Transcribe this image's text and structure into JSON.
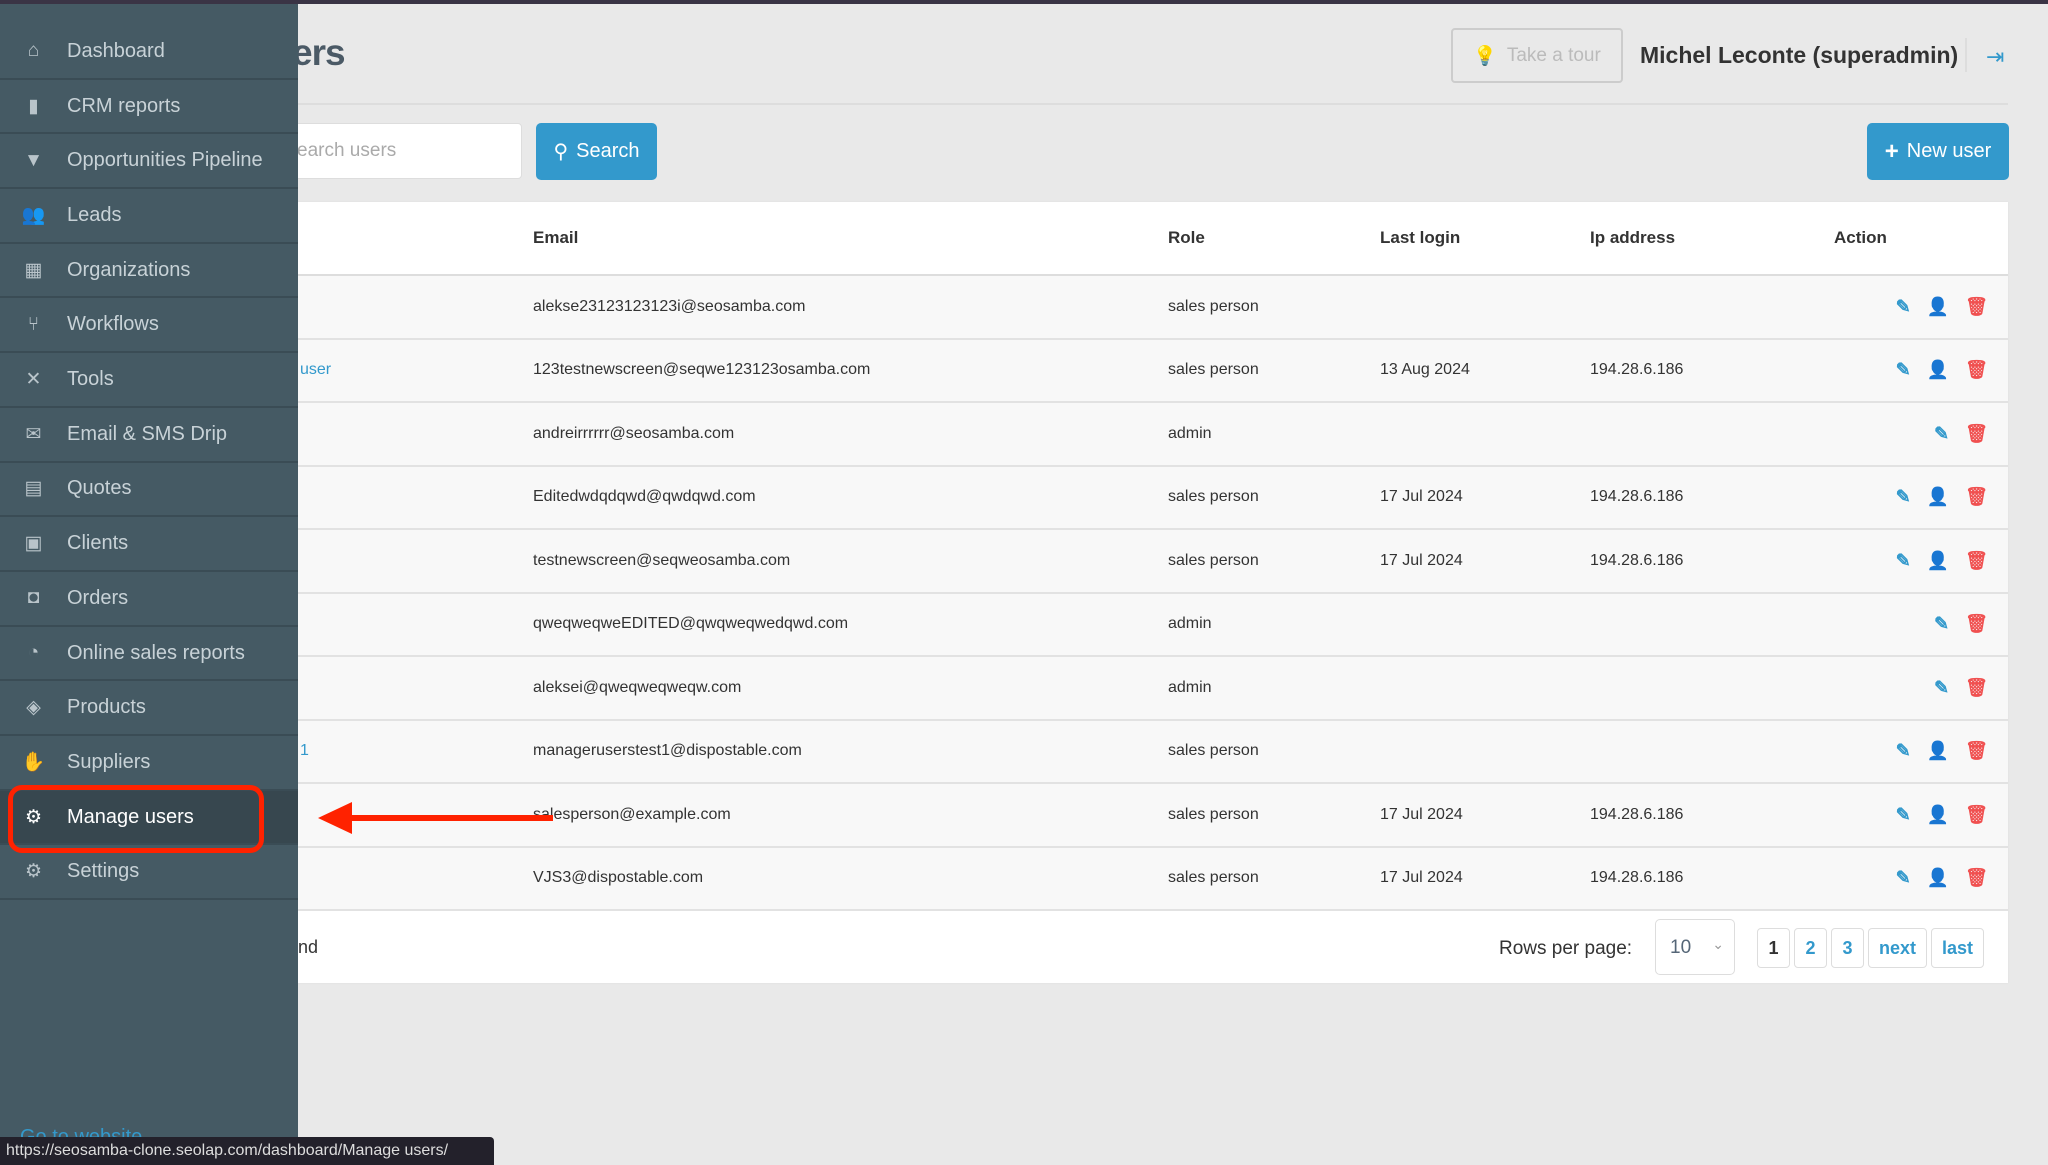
{
  "header": {
    "title_partial": "ers",
    "tour_label": "Take a tour",
    "user_name": "Michel Leconte (superadmin)"
  },
  "toolbar": {
    "search_placeholder": "earch users",
    "search_label": "Search",
    "new_user_label": "New user"
  },
  "table": {
    "columns": [
      "Email",
      "Role",
      "Last login",
      "Ip address",
      "Action"
    ],
    "rows": [
      {
        "name": "",
        "email": "alekse23123123123i@seosamba.com",
        "role": "sales person",
        "last_login": "",
        "ip": "",
        "impersonate": true
      },
      {
        "name": "user",
        "email": "123testnewscreen@seqwe123123osamba.com",
        "role": "sales person",
        "last_login": "13 Aug 2024",
        "ip": "194.28.6.186",
        "impersonate": true
      },
      {
        "name": "",
        "email": "andreirrrrrr@seosamba.com",
        "role": "admin",
        "last_login": "",
        "ip": "",
        "impersonate": false
      },
      {
        "name": "",
        "email": "Editedwdqdqwd@qwdqwd.com",
        "role": "sales person",
        "last_login": "17 Jul 2024",
        "ip": "194.28.6.186",
        "impersonate": true
      },
      {
        "name": "",
        "email": "testnewscreen@seqweosamba.com",
        "role": "sales person",
        "last_login": "17 Jul 2024",
        "ip": "194.28.6.186",
        "impersonate": true
      },
      {
        "name": "",
        "email": "qweqweqweEDITED@qwqweqwedqwd.com",
        "role": "admin",
        "last_login": "",
        "ip": "",
        "impersonate": false
      },
      {
        "name": "",
        "email": "aleksei@qweqweqweqw.com",
        "role": "admin",
        "last_login": "",
        "ip": "",
        "impersonate": false
      },
      {
        "name": "1",
        "email": "manageruserstest1@dispostable.com",
        "role": "sales person",
        "last_login": "",
        "ip": "",
        "impersonate": true
      },
      {
        "name": "",
        "email": "salesperson@example.com",
        "role": "sales person",
        "last_login": "17 Jul 2024",
        "ip": "194.28.6.186",
        "impersonate": true
      },
      {
        "name": "",
        "email": "VJS3@dispostable.com",
        "role": "sales person",
        "last_login": "17 Jul 2024",
        "ip": "194.28.6.186",
        "impersonate": true
      }
    ]
  },
  "footer": {
    "left_partial": "nd",
    "rows_per_page_label": "Rows per page:",
    "rows_per_page": "10",
    "pages": [
      "1",
      "2",
      "3",
      "next",
      "last"
    ],
    "current_page": "1"
  },
  "sidebar": {
    "items": [
      {
        "label": "Dashboard",
        "icon": "home-icon",
        "glyph": "⌂"
      },
      {
        "label": "CRM reports",
        "icon": "bar-chart-icon",
        "glyph": "▮"
      },
      {
        "label": "Opportunities Pipeline",
        "icon": "funnel-icon",
        "glyph": "▼"
      },
      {
        "label": "Leads",
        "icon": "users-icon",
        "glyph": "👥"
      },
      {
        "label": "Organizations",
        "icon": "building-icon",
        "glyph": "▦"
      },
      {
        "label": "Workflows",
        "icon": "sitemap-icon",
        "glyph": "⑂"
      },
      {
        "label": "Tools",
        "icon": "tools-icon",
        "glyph": "✕"
      },
      {
        "label": "Email & SMS Drip",
        "icon": "envelope-icon",
        "glyph": "✉"
      },
      {
        "label": "Quotes",
        "icon": "document-icon",
        "glyph": "▤"
      },
      {
        "label": "Clients",
        "icon": "id-badge-icon",
        "glyph": "▣"
      },
      {
        "label": "Orders",
        "icon": "bag-icon",
        "glyph": "◘"
      },
      {
        "label": "Online sales reports",
        "icon": "pie-chart-icon",
        "glyph": "◔"
      },
      {
        "label": "Products",
        "icon": "tags-icon",
        "glyph": "◈"
      },
      {
        "label": "Suppliers",
        "icon": "handshake-icon",
        "glyph": "✋"
      },
      {
        "label": "Manage users",
        "icon": "user-gear-icon",
        "glyph": "⚙"
      },
      {
        "label": "Settings",
        "icon": "gear-icon",
        "glyph": "⚙"
      }
    ],
    "active": "Manage users",
    "goto_label": "Go to website"
  },
  "status_url": "https://seosamba-clone.seolap.com/dashboard/Manage users/",
  "colors": {
    "sidebar": "#455a64",
    "accent": "#3399cc",
    "danger": "#f05050",
    "annotation": "#ff2200"
  }
}
